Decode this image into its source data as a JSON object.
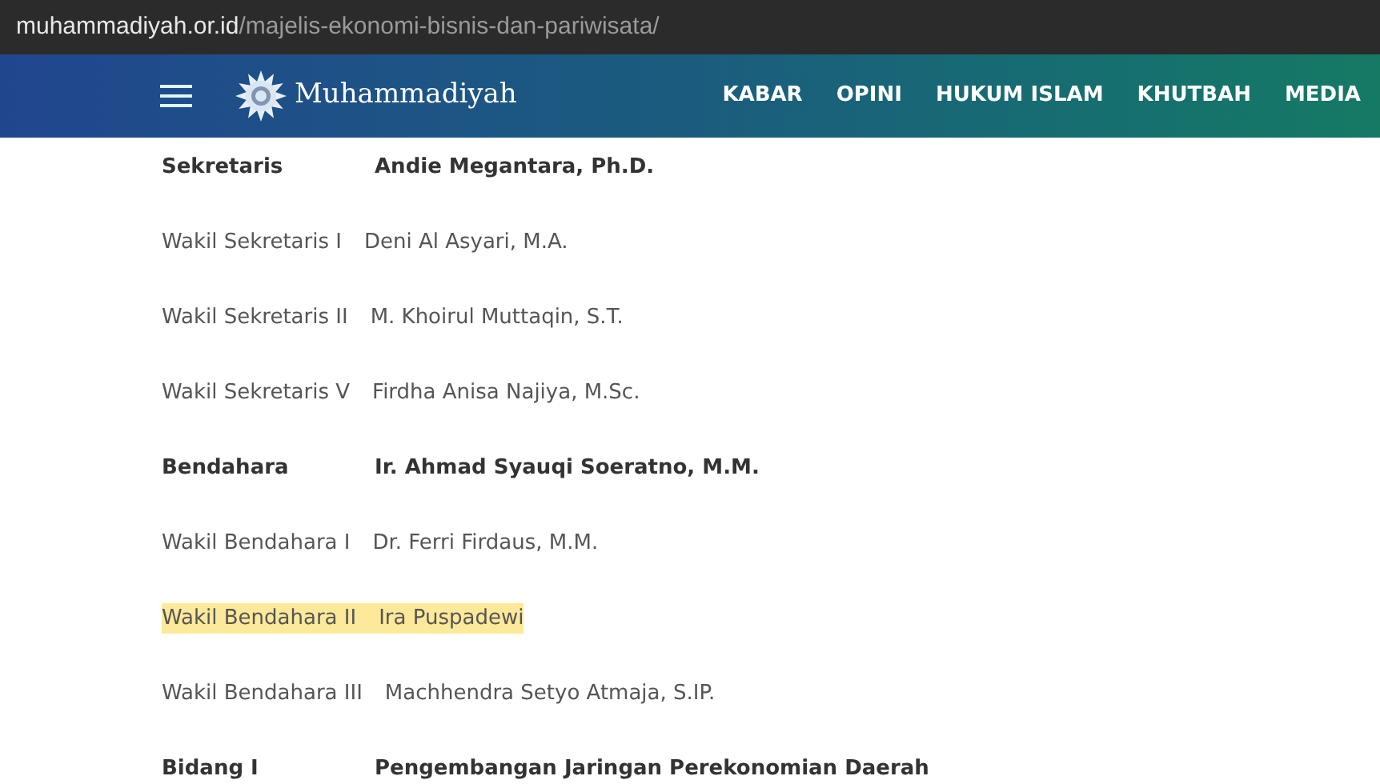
{
  "address_bar": {
    "domain": "muhammadiyah.or.id",
    "path": "/majelis-ekonomi-bisnis-dan-pariwisata/"
  },
  "nav": {
    "logo_text": "Muhammadiyah",
    "items": [
      "KABAR",
      "OPINI",
      "HUKUM ISLAM",
      "KHUTBAH",
      "MEDIA"
    ]
  },
  "rows": [
    {
      "label": "Sekretaris",
      "value": "Andie Megantara, Ph.D.",
      "bold": true,
      "highlighted": false
    },
    {
      "label": "Wakil Sekretaris I",
      "value": "Deni Al Asyari, M.A.",
      "bold": false,
      "highlighted": false
    },
    {
      "label": "Wakil Sekretaris II",
      "value": "M. Khoirul Muttaqin, S.T.",
      "bold": false,
      "highlighted": false
    },
    {
      "label": "Wakil Sekretaris V",
      "value": "Firdha Anisa Najiya, M.Sc.",
      "bold": false,
      "highlighted": false
    },
    {
      "label": "Bendahara",
      "value": "Ir. Ahmad Syauqi Soeratno, M.M.",
      "bold": true,
      "highlighted": false
    },
    {
      "label": "Wakil Bendahara I",
      "value": "Dr. Ferri Firdaus, M.M.",
      "bold": false,
      "highlighted": false
    },
    {
      "label": "Wakil Bendahara II",
      "value": "Ira Puspadewi",
      "bold": false,
      "highlighted": true
    },
    {
      "label": "Wakil Bendahara III",
      "value": "Machhendra Setyo Atmaja, S.IP.",
      "bold": false,
      "highlighted": false
    },
    {
      "label": "Bidang I",
      "value": "Pengembangan Jaringan Perekonomian Daerah",
      "bold": true,
      "highlighted": false
    }
  ]
}
